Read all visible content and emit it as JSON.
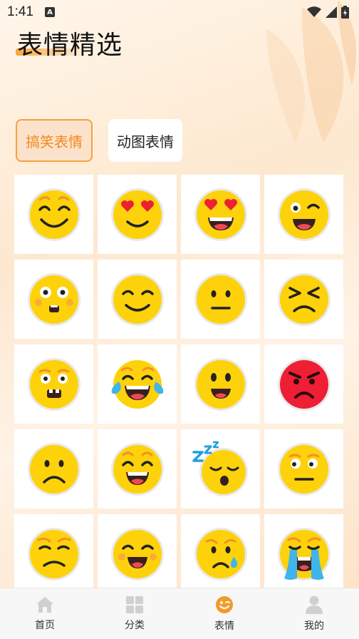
{
  "status_bar": {
    "time": "1:41"
  },
  "header": {
    "title": "表情精选"
  },
  "tabs": [
    {
      "label": "搞笑表情",
      "active": true
    },
    {
      "label": "动图表情",
      "active": false
    }
  ],
  "emojis": [
    {
      "name": "smiling-eyes-emoji"
    },
    {
      "name": "heart-eyes-smile-emoji"
    },
    {
      "name": "heart-eyes-grin-emoji"
    },
    {
      "name": "wink-emoji"
    },
    {
      "name": "flushed-emoji"
    },
    {
      "name": "content-smile-emoji"
    },
    {
      "name": "neutral-emoji"
    },
    {
      "name": "squint-frown-emoji"
    },
    {
      "name": "grimace-emoji"
    },
    {
      "name": "tears-of-joy-emoji"
    },
    {
      "name": "happy-open-mouth-emoji"
    },
    {
      "name": "angry-red-emoji"
    },
    {
      "name": "frowning-emoji"
    },
    {
      "name": "grinning-emoji"
    },
    {
      "name": "sleeping-emoji"
    },
    {
      "name": "unamused-emoji"
    },
    {
      "name": "displeased-emoji"
    },
    {
      "name": "beaming-emoji"
    },
    {
      "name": "sad-tear-emoji"
    },
    {
      "name": "loudly-crying-emoji"
    }
  ],
  "bottom_nav": [
    {
      "label": "首页",
      "icon": "home-icon",
      "active": false
    },
    {
      "label": "分类",
      "icon": "grid-icon",
      "active": false
    },
    {
      "label": "表情",
      "icon": "wink-face-icon",
      "active": true
    },
    {
      "label": "我的",
      "icon": "person-icon",
      "active": false
    }
  ],
  "colors": {
    "accent": "#f5a23e",
    "emoji_yellow": "#fdd20a",
    "angry_red": "#ee1f35"
  }
}
